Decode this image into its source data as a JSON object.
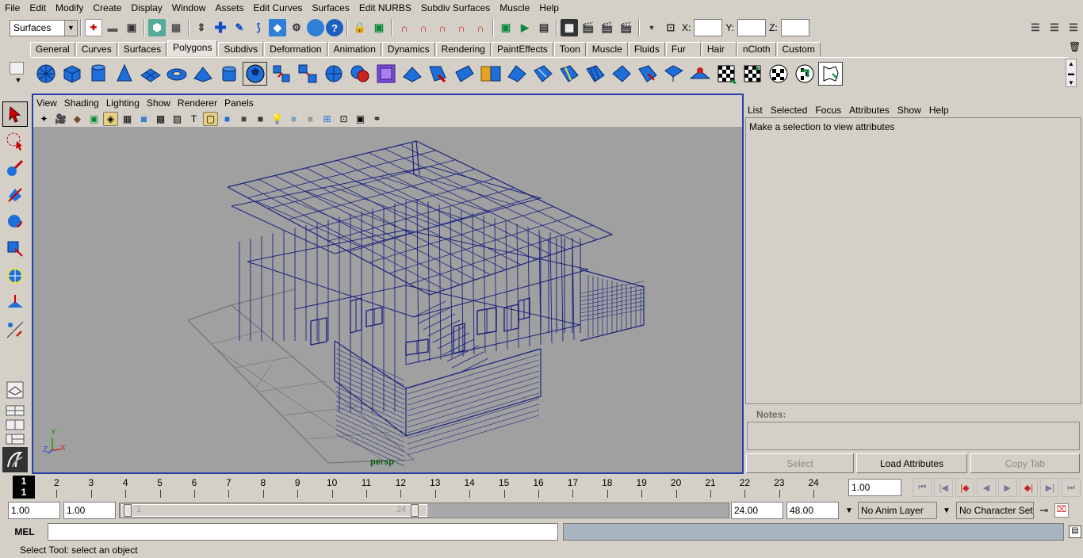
{
  "menubar": [
    "File",
    "Edit",
    "Modify",
    "Create",
    "Display",
    "Window",
    "Assets",
    "Edit Curves",
    "Surfaces",
    "Edit NURBS",
    "Subdiv Surfaces",
    "Muscle",
    "Help"
  ],
  "status": {
    "menu_set": "Surfaces",
    "x_label": "X:",
    "y_label": "Y:",
    "z_label": "Z:"
  },
  "shelf_tabs": [
    "General",
    "Curves",
    "Surfaces",
    "Polygons",
    "Subdivs",
    "Deformation",
    "Animation",
    "Dynamics",
    "Rendering",
    "PaintEffects",
    "Toon",
    "Muscle",
    "Fluids",
    "Fur",
    "Hair",
    "nCloth",
    "Custom"
  ],
  "active_tab": "Polygons",
  "viewport": {
    "menu": [
      "View",
      "Shading",
      "Lighting",
      "Show",
      "Renderer",
      "Panels"
    ],
    "camera_label": "persp",
    "axis_x": "X",
    "axis_y": "Y",
    "axis_z": "Z"
  },
  "attribute_editor": {
    "menu": [
      "List",
      "Selected",
      "Focus",
      "Attributes",
      "Show",
      "Help"
    ],
    "message": "Make a selection to view attributes",
    "notes_label": "Notes:",
    "buttons": {
      "select": "Select",
      "load": "Load Attributes",
      "copy": "Copy Tab"
    }
  },
  "timeline": {
    "current_frame_top": "1",
    "current_frame_bottom": "1",
    "ticks": [
      "2",
      "3",
      "4",
      "5",
      "6",
      "7",
      "8",
      "9",
      "10",
      "11",
      "12",
      "13",
      "14",
      "15",
      "16",
      "17",
      "18",
      "19",
      "20",
      "21",
      "22",
      "23",
      "24"
    ],
    "current_time": "1.00"
  },
  "range": {
    "start": "1.00",
    "playback_start": "1.00",
    "slider_start": "1",
    "slider_end": "24",
    "playback_end": "24.00",
    "end": "48.00",
    "anim_layer": "No Anim Layer",
    "character_set": "No Character Set"
  },
  "command": {
    "label": "MEL"
  },
  "help_line": "Select Tool: select an object",
  "colors": {
    "ui_bg": "#d4d0c8",
    "viewport_bg": "#a0a0a0",
    "wireframe": "#1a237e",
    "active_border": "#2b3ea8",
    "camera_label": "#0f5a14"
  }
}
